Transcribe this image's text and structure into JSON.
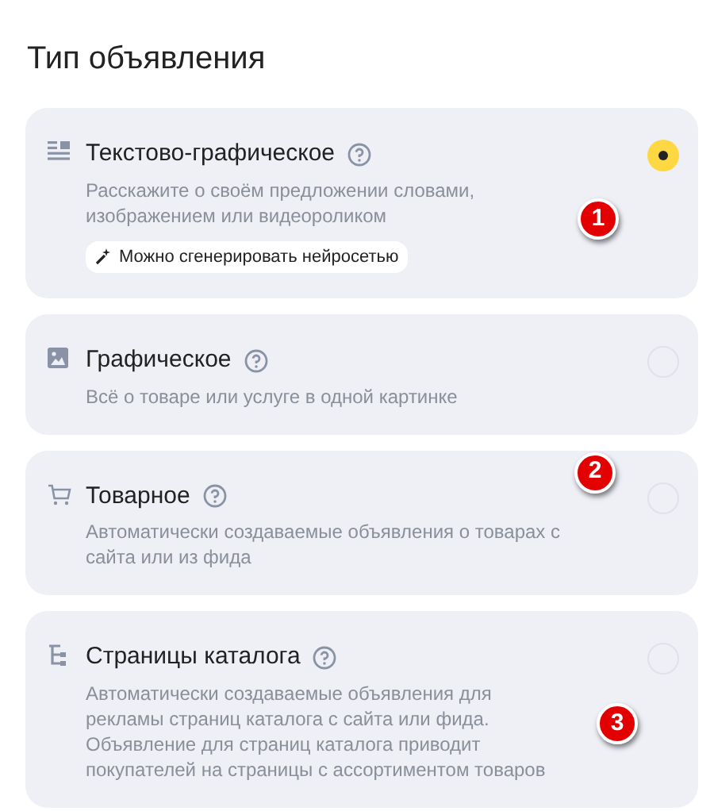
{
  "title": "Тип объявления",
  "options": [
    {
      "kind": "text-graphic",
      "title": "Текстово-графическое",
      "description": "Расскажите о своём предложении словами, изображением или видеороликом",
      "tag": "Можно сгенерировать нейросетью",
      "selected": true,
      "marker": "1"
    },
    {
      "kind": "graphic",
      "title": "Графическое",
      "description": "Всё о товаре или услуге в одной картинке",
      "selected": false
    },
    {
      "kind": "product",
      "title": "Товарное",
      "description": "Автоматически создаваемые объявления о товарах с сайта или из фида",
      "selected": false,
      "marker": "2"
    },
    {
      "kind": "catalog",
      "title": "Страницы каталога",
      "description": "Автоматически создаваемые объявления для рекламы страниц каталога с сайта или фида. Объявление для страниц каталога приводит покупателей на страницы с ассортиментом товаров",
      "selected": false,
      "marker": "3"
    }
  ]
}
